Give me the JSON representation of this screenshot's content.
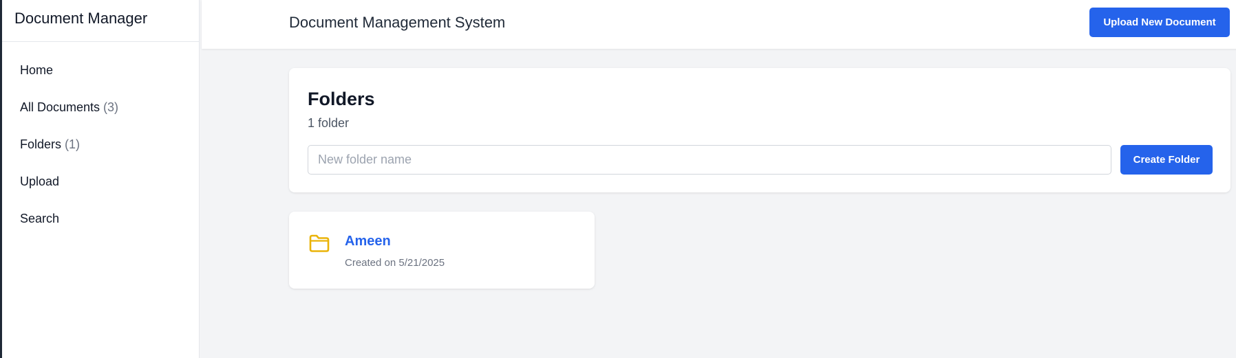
{
  "sidebar": {
    "brand": "Document Manager",
    "items": [
      {
        "label": "Home",
        "count": ""
      },
      {
        "label": "All Documents",
        "count": "(3)"
      },
      {
        "label": "Folders",
        "count": "(1)"
      },
      {
        "label": "Upload",
        "count": ""
      },
      {
        "label": "Search",
        "count": ""
      }
    ]
  },
  "header": {
    "title": "Document Management System",
    "upload_label": "Upload New Document"
  },
  "folders_panel": {
    "title": "Folders",
    "count_text": "1 folder",
    "input_placeholder": "New folder name",
    "input_value": "",
    "create_label": "Create Folder"
  },
  "folders": [
    {
      "name": "Ameen",
      "created": "Created on 5/21/2025",
      "icon": "folder-icon"
    }
  ],
  "colors": {
    "accent": "#2563eb",
    "folder_icon": "#eab308",
    "background": "#f3f4f6"
  }
}
